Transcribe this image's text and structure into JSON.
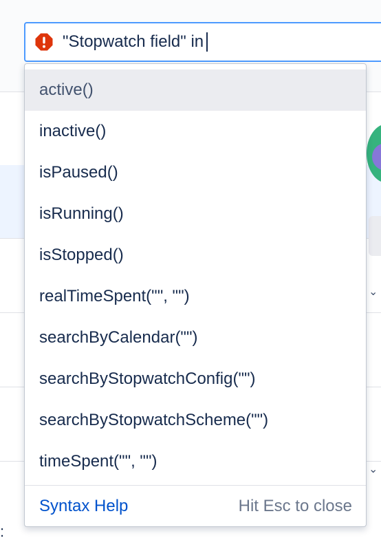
{
  "search": {
    "query": "\"Stopwatch field\" in",
    "status_icon": "error-icon",
    "error_color": "#de350b",
    "focus_color": "#4c9aff"
  },
  "suggestions": [
    {
      "label": "active()",
      "highlighted": true
    },
    {
      "label": "inactive()"
    },
    {
      "label": "isPaused()"
    },
    {
      "label": "isRunning()"
    },
    {
      "label": "isStopped()"
    },
    {
      "label": "realTimeSpent(\"\", \"\")"
    },
    {
      "label": "searchByCalendar(\"\")"
    },
    {
      "label": "searchByStopwatchConfig(\"\")"
    },
    {
      "label": "searchByStopwatchScheme(\"\")"
    },
    {
      "label": "timeSpent(\"\", \"\")"
    }
  ],
  "footer": {
    "syntax_help_label": "Syntax Help",
    "hint": "Hit Esc to close",
    "link_color": "#0052cc"
  }
}
